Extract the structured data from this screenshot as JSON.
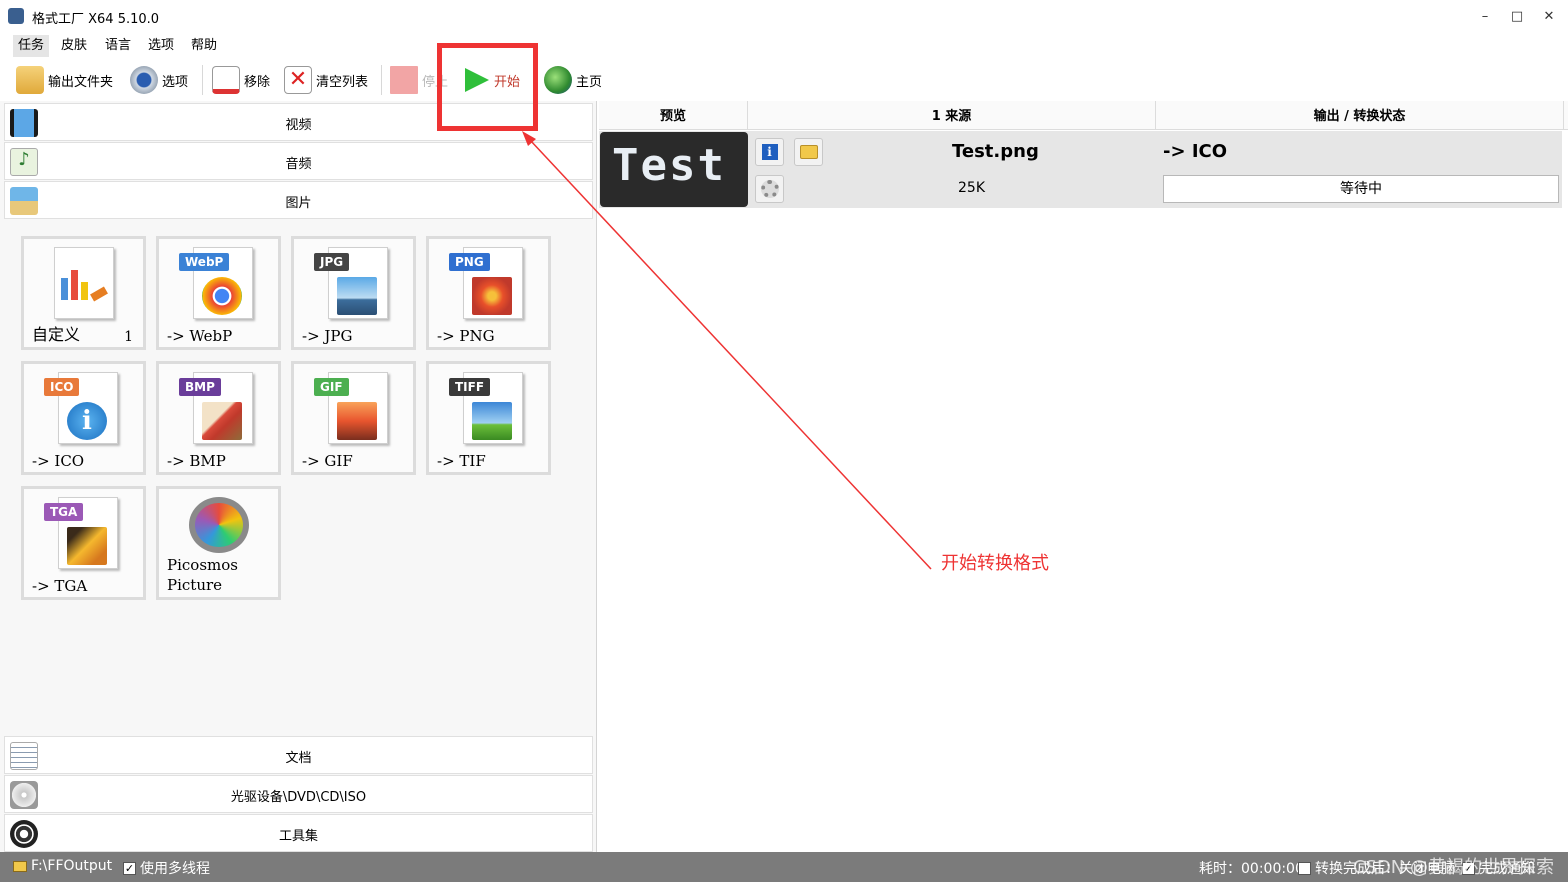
{
  "window": {
    "title": "格式工厂 X64 5.10.0",
    "minimize": "–",
    "maximize": "□",
    "close": "✕"
  },
  "menu": [
    "任务",
    "皮肤",
    "语言",
    "选项",
    "帮助"
  ],
  "toolbar": {
    "output_folder": "输出文件夹",
    "options": "选项",
    "remove": "移除",
    "clear_list": "清空列表",
    "stop": "停止",
    "start": "开始",
    "home": "主页"
  },
  "categories": {
    "video": "视频",
    "audio": "音频",
    "image": "图片",
    "document": "文档",
    "disc": "光驱设备\\DVD\\CD\\ISO",
    "tools": "工具集"
  },
  "tiles": [
    {
      "label": "自定义",
      "count": "1",
      "badge": "",
      "color": "#e67e22",
      "icon": "custom-chart-icon"
    },
    {
      "label": "-> WebP",
      "badge": "WebP",
      "color": "#3b82d6",
      "icon": "chrome-icon"
    },
    {
      "label": "-> JPG",
      "badge": "JPG",
      "color": "#444444",
      "icon": "landscape-photo-icon"
    },
    {
      "label": "-> PNG",
      "badge": "PNG",
      "color": "#2f6fd0",
      "icon": "flower-photo-icon"
    },
    {
      "label": "-> ICO",
      "badge": "ICO",
      "color": "#e8793a",
      "icon": "info-icon"
    },
    {
      "label": "-> BMP",
      "badge": "BMP",
      "color": "#6a3d9a",
      "icon": "paint-icon"
    },
    {
      "label": "-> GIF",
      "badge": "GIF",
      "color": "#4caf50",
      "icon": "sunset-photo-icon"
    },
    {
      "label": "-> TIF",
      "badge": "TIFF",
      "color": "#3a3a3a",
      "icon": "field-photo-icon"
    },
    {
      "label": "-> TGA",
      "badge": "TGA",
      "color": "#9b59b6",
      "icon": "tga-photo-icon"
    },
    {
      "label": "Picosmos\nPicture",
      "badge": "",
      "color": "#888888",
      "icon": "picosmos-icon"
    }
  ],
  "grid": {
    "col_preview": "预览",
    "col_source": "1 来源",
    "col_output": "输出 / 转换状态"
  },
  "task": {
    "preview_text": "Test",
    "file_name": "Test.png",
    "file_size": "25K",
    "output_format": "-> ICO",
    "status": "等待中"
  },
  "annotation": "开始转换格式",
  "statusbar": {
    "output_path": "F:\\FFOutput",
    "multithread_label": "使用多线程",
    "elapsed": "耗时：00:00:00",
    "after_convert": "转换完成后：关闭电脑",
    "notify": "完成通知",
    "watermark": "CSDN @黄褐的世界探索"
  }
}
